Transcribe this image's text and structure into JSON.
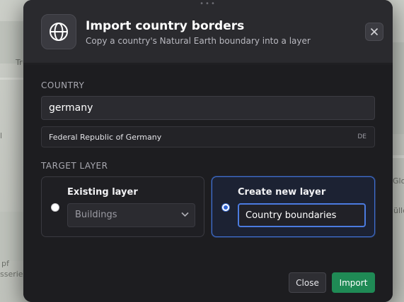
{
  "map": {
    "labels": [
      "Tr",
      "l",
      "pf",
      "sserie",
      "Glo",
      "ülle"
    ]
  },
  "dialog": {
    "title": "Import country borders",
    "subtitle": "Copy a country's Natural Earth boundary into a layer",
    "header_icon": "globe-icon",
    "close_icon": "close-icon",
    "drag_handle": "•••"
  },
  "country": {
    "section_label": "COUNTRY",
    "input_value": "germany",
    "suggestion": {
      "name": "Federal Republic of Germany",
      "code": "DE"
    }
  },
  "target_layer": {
    "section_label": "TARGET LAYER",
    "existing": {
      "label": "Existing layer",
      "selected_value": "Buildings",
      "selected": false
    },
    "create_new": {
      "label": "Create new layer",
      "input_value": "Country boundaries",
      "selected": true
    }
  },
  "footer": {
    "close_label": "Close",
    "import_label": "Import"
  },
  "colors": {
    "accent_blue": "#3f6fd1",
    "import_green": "#1f8a55",
    "dialog_bg": "#1d1d20"
  }
}
